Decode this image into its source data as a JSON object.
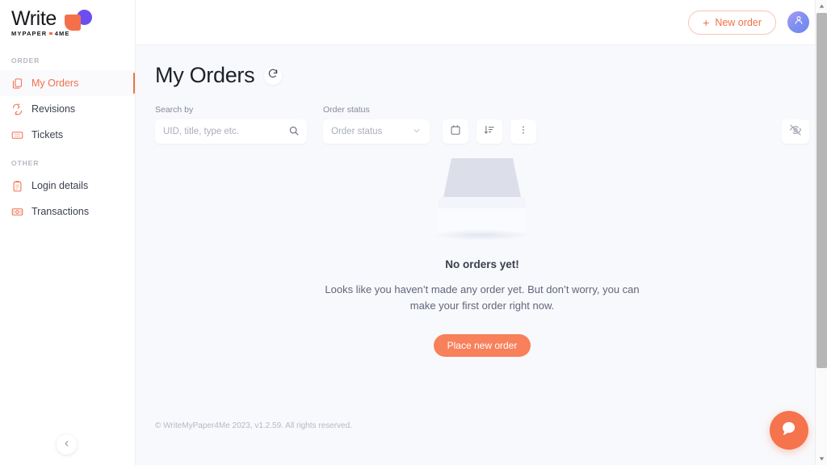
{
  "brand": {
    "name": "Write",
    "tagline_left": "MYPAPER",
    "tagline_right": "4ME",
    "accent_orange": "#f0714b",
    "accent_purple": "#6c4df2"
  },
  "topbar": {
    "new_order_label": "New order",
    "plus_glyph": "+",
    "avatar_icon": "user-icon"
  },
  "sidebar": {
    "sections": [
      {
        "label": "ORDER",
        "items": [
          {
            "label": "My Orders",
            "icon": "documents-icon",
            "active": true
          },
          {
            "label": "Revisions",
            "icon": "refresh-loop-icon",
            "active": false
          },
          {
            "label": "Tickets",
            "icon": "ticket-icon",
            "active": false
          }
        ]
      },
      {
        "label": "OTHER",
        "items": [
          {
            "label": "Login details",
            "icon": "clipboard-icon",
            "active": false
          },
          {
            "label": "Transactions",
            "icon": "banknote-icon",
            "active": false
          }
        ]
      }
    ],
    "collapse_icon": "chevron-left-icon"
  },
  "page": {
    "title": "My Orders",
    "refresh_icon": "refresh-icon"
  },
  "filters": {
    "search_label": "Search by",
    "search_placeholder": "UID, title, type etc.",
    "search_value": "",
    "search_icon": "search-icon",
    "status_label": "Order status",
    "status_value": "Order status",
    "status_options": [
      "Order status"
    ],
    "chevron_icon": "chevron-down-icon",
    "calendar_icon": "calendar-icon",
    "sort_icon": "sort-descending-icon",
    "more_icon": "more-vertical-icon",
    "hide_icon": "eye-off-icon"
  },
  "empty_state": {
    "illustration": "empty-inbox-illustration",
    "title": "No orders yet!",
    "message": "Looks like you haven’t made any order yet. But don’t worry, you can make your first order right now.",
    "cta_label": "Place new order"
  },
  "footer": {
    "text": "© WriteMyPaper4Me 2023, v1.2.59. All rights reserved."
  },
  "chat": {
    "icon": "chat-bubble-icon"
  }
}
